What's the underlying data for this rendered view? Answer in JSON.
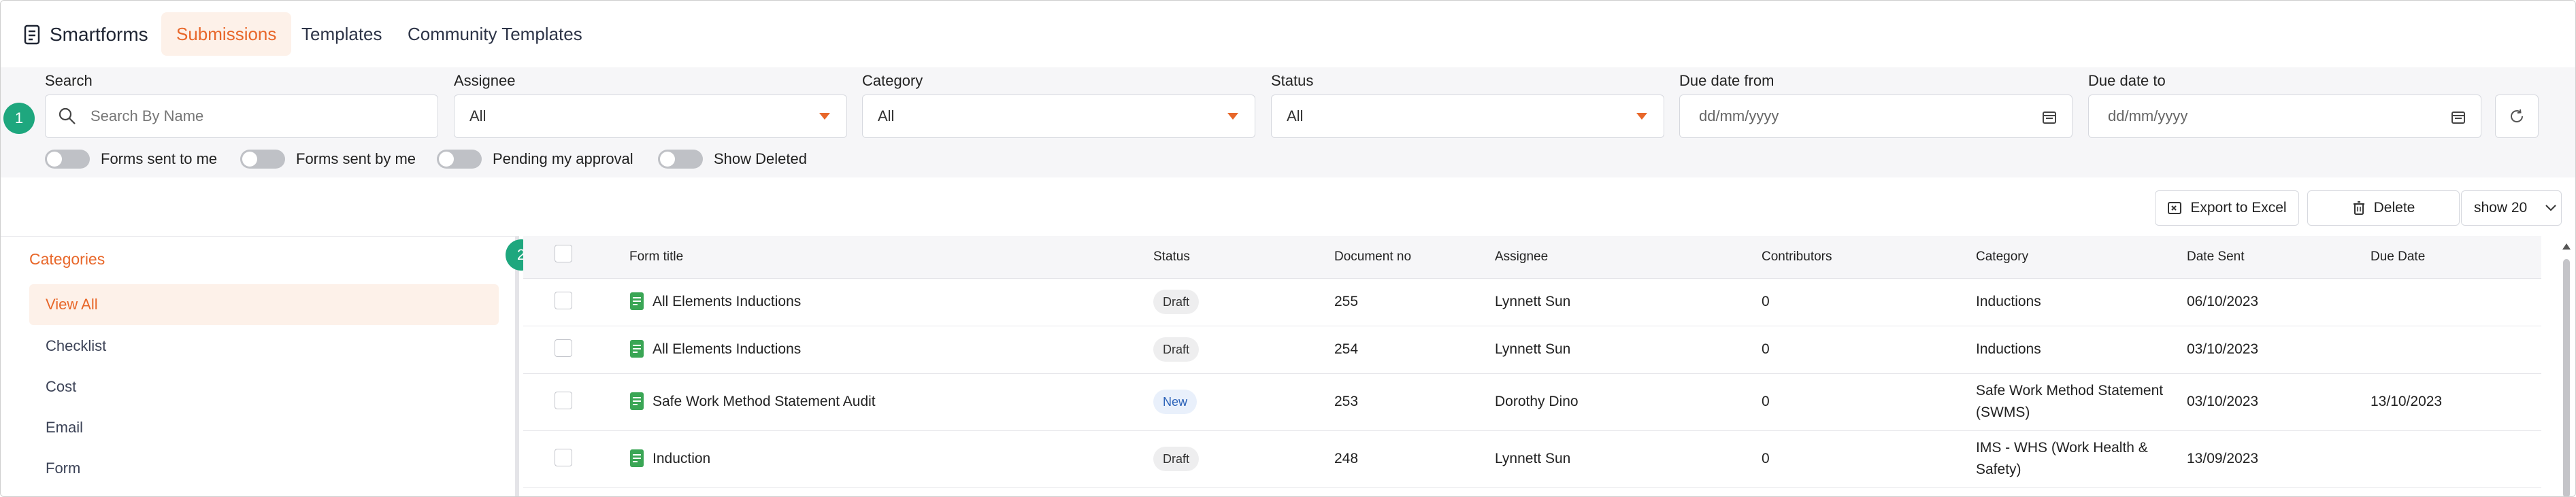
{
  "app": {
    "brand": "Smartforms",
    "tabs": [
      {
        "label": "Submissions",
        "active": true
      },
      {
        "label": "Templates",
        "active": false
      },
      {
        "label": "Community Templates",
        "active": false
      }
    ],
    "accent_color": "#e8672a",
    "badge_color": "#1ea77e"
  },
  "filters": {
    "search_label": "Search",
    "search_placeholder": "Search By Name",
    "assignee_label": "Assignee",
    "assignee_value": "All",
    "category_label": "Category",
    "category_value": "All",
    "status_label": "Status",
    "status_value": "All",
    "due_from_label": "Due date from",
    "due_from_placeholder": "dd/mm/yyyy",
    "due_to_label": "Due date to",
    "due_to_placeholder": "dd/mm/yyyy",
    "toggles": [
      {
        "label": "Forms sent to me",
        "on": false
      },
      {
        "label": "Forms sent by me",
        "on": false
      },
      {
        "label": "Pending my approval",
        "on": false
      },
      {
        "label": "Show Deleted",
        "on": false
      }
    ],
    "refresh_icon": "refresh-icon"
  },
  "badges": {
    "one": "1",
    "two": "2"
  },
  "toolbar": {
    "export_label": "Export to Excel",
    "delete_label": "Delete",
    "show_label": "show 20"
  },
  "categories": {
    "title": "Categories",
    "items": [
      {
        "label": "View All",
        "active": true
      },
      {
        "label": "Checklist",
        "active": false
      },
      {
        "label": "Cost",
        "active": false
      },
      {
        "label": "Email",
        "active": false
      },
      {
        "label": "Form",
        "active": false
      }
    ]
  },
  "table": {
    "headers": {
      "form_title": "Form title",
      "status": "Status",
      "document_no": "Document no",
      "assignee": "Assignee",
      "contributors": "Contributors",
      "category": "Category",
      "date_sent": "Date Sent",
      "due_date": "Due Date"
    },
    "rows": [
      {
        "title": "All Elements Inductions",
        "status": "Draft",
        "doc": "255",
        "assignee": "Lynnett Sun",
        "contributors": "0",
        "category_1": "Inductions",
        "category_2": "",
        "date_sent": "06/10/2023",
        "due_date": ""
      },
      {
        "title": "All Elements Inductions",
        "status": "Draft",
        "doc": "254",
        "assignee": "Lynnett Sun",
        "contributors": "0",
        "category_1": "Inductions",
        "category_2": "",
        "date_sent": "03/10/2023",
        "due_date": ""
      },
      {
        "title": "Safe Work Method Statement Audit",
        "status": "New",
        "doc": "253",
        "assignee": "Dorothy Dino",
        "contributors": "0",
        "category_1": "Safe Work Method Statement",
        "category_2": "(SWMS)",
        "date_sent": "03/10/2023",
        "due_date": "13/10/2023"
      },
      {
        "title": "Induction",
        "status": "Draft",
        "doc": "248",
        "assignee": "Lynnett Sun",
        "contributors": "0",
        "category_1": "IMS - WHS (Work Health &",
        "category_2": "Safety)",
        "date_sent": "13/09/2023",
        "due_date": ""
      }
    ]
  }
}
